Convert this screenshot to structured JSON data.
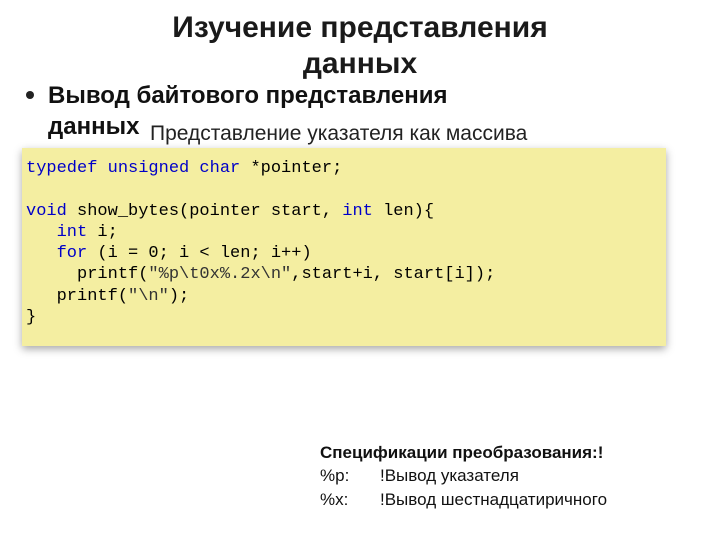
{
  "title_line1": "Изучение представления",
  "title_line2": "данных",
  "bullet_line1": "Вывод байтового представления",
  "bullet_line2": "данных",
  "sub": "Представление указателя как массива",
  "code": {
    "typedef_kw": "typedef unsigned char",
    "typedef_rest": " *pointer;",
    "void_kw": "void",
    "fn_sig": " show_bytes(pointer start, ",
    "int_kw": "int",
    "fn_sig2": " len){",
    "int_decl_kw": "   int",
    "int_decl_rest": " i;",
    "for_kw": "   for",
    "for_rest": " (i = 0; i < len; i++)",
    "printf1a": "     printf(",
    "printf1b": "\"%p\\t0x%.2x\\n\"",
    "printf1c": ",start+i, start[i]);",
    "printf2a": "   printf(",
    "printf2b": "\"\\n\"",
    "printf2c": ");",
    "close": "}"
  },
  "spec": {
    "header": "Спецификации преобразования:!",
    "p_key": "%p:",
    "p_val": "!Вывод указателя",
    "x_key": "%x:",
    "x_val": "!Вывод шестнадцатиричного"
  }
}
